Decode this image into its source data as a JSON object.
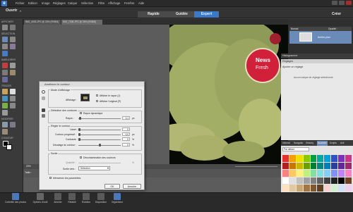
{
  "menubar": {
    "logo": "e",
    "items": [
      "Fichier",
      "Edition",
      "Image",
      "Réglages",
      "Calque",
      "Sélection",
      "Filtre",
      "Affichage",
      "Fenêtre",
      "Aide"
    ]
  },
  "modebar": {
    "open_label": "Ouvrir",
    "tabs": [
      {
        "label": "Rapide"
      },
      {
        "label": "Guidée"
      },
      {
        "label": "Expert"
      }
    ],
    "create_label": "Créer"
  },
  "toolbar": {
    "sections": [
      "AFFICHER",
      "SÉLECTION",
      "AMÉLIORER",
      "TRACER",
      "MODIFIER",
      "COULEUR"
    ]
  },
  "doc_tabs": [
    {
      "label": "IMG_4003.JPG @ 25% (RVB/8)"
    },
    {
      "label": "IMG_7008.JPG @ 25% (RVB/8)"
    }
  ],
  "zoom_label": "20%",
  "taille_label": "Taille :",
  "layers": {
    "mode": "Normal",
    "opacity_label": "Opacité :",
    "layer_name": "Arrière-plan"
  },
  "reglages": {
    "header_tab": "Histogramme",
    "tab": "Réglages",
    "add_label": "Ajouter un réglage",
    "empty_label": "Aucun calque de réglage sélectionné"
  },
  "swatches": {
    "tabs": [
      "Infomat",
      "Navigatio",
      "Historiq",
      "Nuancier",
      "Scripts",
      "Acti"
    ],
    "set_label": "Par défaut",
    "colors": [
      "#e63030",
      "#f5a000",
      "#f0e000",
      "#8cc800",
      "#00a040",
      "#00a8a0",
      "#00a0e0",
      "#3050c8",
      "#8030c0",
      "#d03090",
      "#b02020",
      "#c87800",
      "#c8b800",
      "#6ca000",
      "#008030",
      "#008880",
      "#0080b8",
      "#2840a0",
      "#602898",
      "#a02870",
      "#ff8080",
      "#ffc860",
      "#fff080",
      "#c0f080",
      "#80e0a0",
      "#80e0e0",
      "#80d0ff",
      "#8090ff",
      "#c080ff",
      "#ff80c8",
      "#ffffff",
      "#e0e0e0",
      "#c0c0c0",
      "#a0a0a0",
      "#808080",
      "#606060",
      "#404040",
      "#202020",
      "#000000",
      "#704020",
      "#ffe0c0",
      "#e0c8a0",
      "#c8a878",
      "#a07848",
      "#805830",
      "#604020",
      "#f8d0d0",
      "#d0f0d0",
      "#d0e0f8",
      "#f0d0f0"
    ]
  },
  "bottombar": {
    "items": [
      "Corbeille des photos",
      "Options d'outil",
      "Annuler",
      "Rétablir",
      "Rotation",
      "Disposition",
      "Organiseur"
    ]
  },
  "dialog": {
    "title": "Améliorer le contour",
    "display_group": "Mode d'affichage",
    "display_label": "Affichage :",
    "show_radius": "Afficher le rayon (J)",
    "show_original": "Afficher l'original (P)",
    "edge_group": "Détection des contours",
    "smart_radius": "Rayon dynamique",
    "radius_label": "Rayon :",
    "radius_value": "0,1",
    "radius_unit": "px",
    "adjust_group": "Régler le contour",
    "smooth_label": "Lisser :",
    "smooth_value": "0",
    "feather_label": "Contour progressif :",
    "feather_value": "0,0",
    "feather_unit": "px",
    "contrast_label": "Contraste :",
    "contrast_value": "0",
    "contrast_unit": "%",
    "shift_label": "Décalage du contour :",
    "shift_value": "0",
    "shift_unit": "%",
    "output_group": "Sortie",
    "decontaminate_label": "Décontamination des couleurs",
    "quantity_label": "Quantité :",
    "quantity_unit": "%",
    "output_to_label": "Sortie vers :",
    "output_to_value": "Sélection",
    "remember_label": "Mémoriser les paramètres",
    "ok_label": "OK",
    "cancel_label": "Annuler"
  }
}
